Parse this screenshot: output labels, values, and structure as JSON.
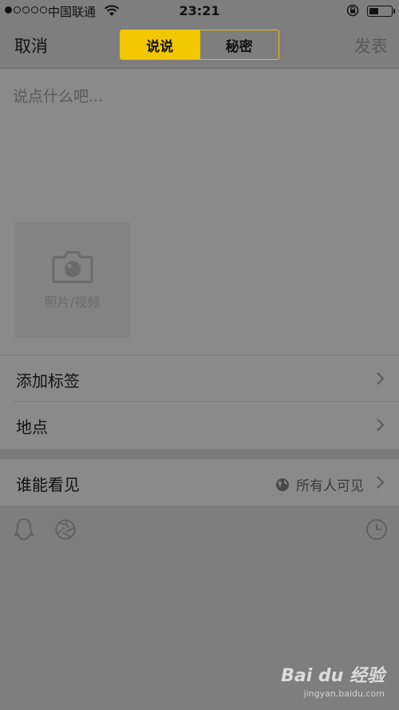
{
  "status_bar": {
    "carrier": "中国联通",
    "time": "23:21",
    "battery_level": 0.45
  },
  "nav": {
    "cancel_label": "取消",
    "publish_label": "发表",
    "tabs": [
      {
        "label": "说说",
        "active": true
      },
      {
        "label": "秘密",
        "active": false
      }
    ]
  },
  "compose": {
    "placeholder": "说点什么吧...",
    "media_label": "照片/视频"
  },
  "options": {
    "tag_label": "添加标签",
    "location_label": "地点"
  },
  "visibility": {
    "label": "谁能看见",
    "value": "所有人可见"
  },
  "watermark": {
    "main": "Bai du 经验",
    "sub": "jingyan.baidu.com"
  },
  "colors": {
    "accent": "#f4c800",
    "background": "#8a8a8a"
  },
  "icons": [
    "camera-icon",
    "chevron-right-icon",
    "globe-icon",
    "qq-penguin-icon",
    "aperture-icon",
    "clock-icon",
    "wifi-icon",
    "lock-rotation-icon",
    "battery-icon"
  ]
}
